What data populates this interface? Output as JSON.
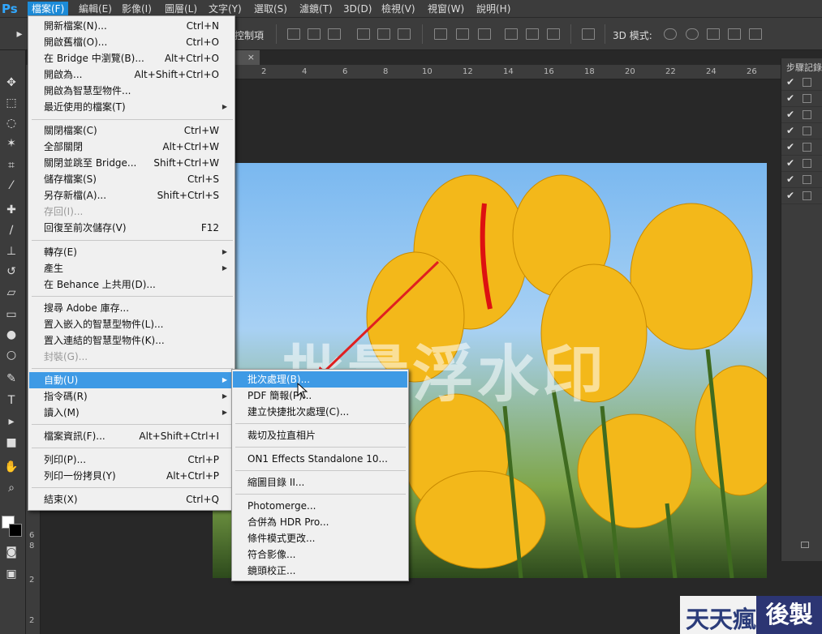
{
  "app": {
    "logo": "Ps"
  },
  "menubar": [
    "檔案(F)",
    "編輯(E)",
    "影像(I)",
    "圖層(L)",
    "文字(Y)",
    "選取(S)",
    "濾鏡(T)",
    "3D(D)",
    "檢視(V)",
    "視窗(W)",
    "說明(H)"
  ],
  "options_bar": {
    "label": "控制項",
    "label_3d": "3D 模式:"
  },
  "ruler_h": [
    "2",
    "4",
    "6",
    "8",
    "10",
    "12",
    "14",
    "16",
    "18",
    "20",
    "22",
    "24",
    "26"
  ],
  "ruler_v": [
    "6",
    "8",
    "2",
    "2"
  ],
  "doc_tab": {
    "close": "×"
  },
  "panel": {
    "title": "步驟記錄"
  },
  "image": {
    "watermark": "批量浮水印"
  },
  "file_menu": {
    "items": [
      {
        "label": "開新檔案(N)...",
        "shortcut": "Ctrl+N"
      },
      {
        "label": "開啟舊檔(O)...",
        "shortcut": "Ctrl+O"
      },
      {
        "label": "在 Bridge 中瀏覽(B)...",
        "shortcut": "Alt+Ctrl+O"
      },
      {
        "label": "開啟為...",
        "shortcut": "Alt+Shift+Ctrl+O"
      },
      {
        "label": "開啟為智慧型物件...",
        "shortcut": ""
      },
      {
        "label": "最近使用的檔案(T)",
        "shortcut": ""
      },
      {
        "label": "關閉檔案(C)",
        "shortcut": "Ctrl+W"
      },
      {
        "label": "全部關閉",
        "shortcut": "Alt+Ctrl+W"
      },
      {
        "label": "關閉並跳至 Bridge...",
        "shortcut": "Shift+Ctrl+W"
      },
      {
        "label": "儲存檔案(S)",
        "shortcut": "Ctrl+S"
      },
      {
        "label": "另存新檔(A)...",
        "shortcut": "Shift+Ctrl+S"
      },
      {
        "label": "存回(I)...",
        "shortcut": ""
      },
      {
        "label": "回復至前次儲存(V)",
        "shortcut": "F12"
      },
      {
        "label": "轉存(E)",
        "shortcut": ""
      },
      {
        "label": "產生",
        "shortcut": ""
      },
      {
        "label": "在 Behance 上共用(D)...",
        "shortcut": ""
      },
      {
        "label": "搜尋 Adobe 庫存...",
        "shortcut": ""
      },
      {
        "label": "置入嵌入的智慧型物件(L)...",
        "shortcut": ""
      },
      {
        "label": "置入連結的智慧型物件(K)...",
        "shortcut": ""
      },
      {
        "label": "封裝(G)...",
        "shortcut": ""
      },
      {
        "label": "自動(U)",
        "shortcut": ""
      },
      {
        "label": "指令碼(R)",
        "shortcut": ""
      },
      {
        "label": "讀入(M)",
        "shortcut": ""
      },
      {
        "label": "檔案資訊(F)...",
        "shortcut": "Alt+Shift+Ctrl+I"
      },
      {
        "label": "列印(P)...",
        "shortcut": "Ctrl+P"
      },
      {
        "label": "列印一份拷貝(Y)",
        "shortcut": "Alt+Ctrl+P"
      },
      {
        "label": "結束(X)",
        "shortcut": "Ctrl+Q"
      }
    ]
  },
  "sub_menu": {
    "items": [
      "批次處理(B)...",
      "PDF 簡報(P)...",
      "建立快捷批次處理(C)...",
      "裁切及拉直相片",
      "ON1 Effects Standalone 10...",
      "縮圖目錄 II...",
      "Photomerge...",
      "合併為 HDR Pro...",
      "條件模式更改...",
      "符合影像...",
      "鏡頭校正..."
    ]
  },
  "brand": {
    "part1": "天天瘋",
    "part2": "後製"
  }
}
